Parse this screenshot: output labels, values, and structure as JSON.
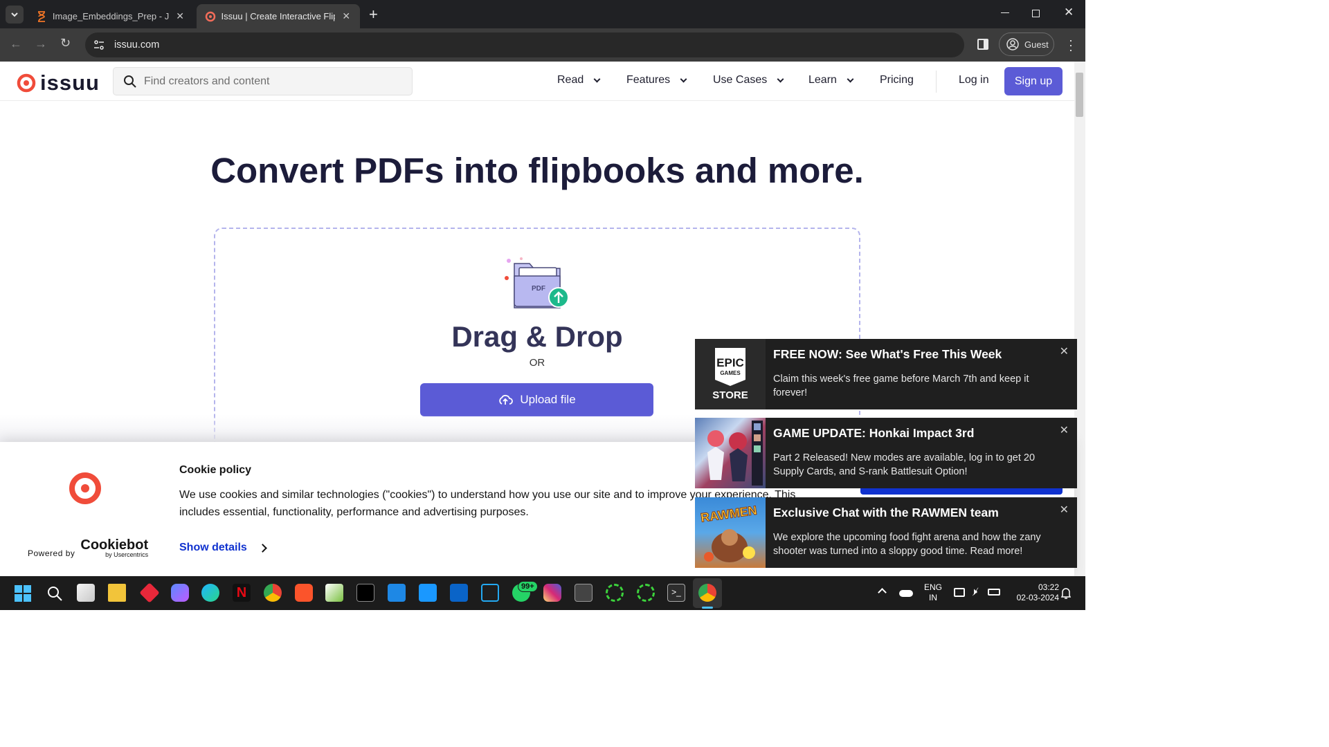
{
  "browser": {
    "tabs": [
      {
        "title": "Image_Embeddings_Prep - Jupy",
        "active": false
      },
      {
        "title": "Issuu | Create Interactive Flipbo",
        "active": true
      }
    ],
    "new_tab_glyph": "+",
    "url": "issuu.com",
    "profile_label": "Guest",
    "window_controls": {
      "minimize": "minimize-icon",
      "restore": "restore-icon",
      "close": "close-icon"
    }
  },
  "site": {
    "logo_text": "issuu",
    "search_placeholder": "Find creators and content",
    "nav": [
      {
        "label": "Read",
        "has_dropdown": true
      },
      {
        "label": "Features",
        "has_dropdown": true
      },
      {
        "label": "Use Cases",
        "has_dropdown": true
      },
      {
        "label": "Learn",
        "has_dropdown": true
      },
      {
        "label": "Pricing",
        "has_dropdown": false
      }
    ],
    "login_label": "Log in",
    "signup_label": "Sign up",
    "hero_title": "Convert PDFs into flipbooks and more.",
    "dropzone": {
      "pdf_label": "PDF",
      "title": "Drag & Drop",
      "or_label": "OR",
      "upload_label": "Upload file"
    },
    "accent_color": "#5b5bd6"
  },
  "cookie_banner": {
    "title": "Cookie policy",
    "text": "We use cookies and similar technologies (\"cookies\") to understand how you use our site and to improve your experience. This includes essential, functionality, performance and advertising purposes.",
    "powered_by": "Powered by",
    "brand": "Cookiebot",
    "brand_sub": "by Usercentrics",
    "show_details": "Show details"
  },
  "notifications": [
    {
      "thumb_line1": "EPIC",
      "thumb_line2": "GAMES",
      "thumb_line3": "STORE",
      "title": "FREE NOW: See What's Free This Week",
      "body": "Claim this week's free game before March 7th and keep it forever!"
    },
    {
      "title": "GAME UPDATE: Honkai Impact 3rd",
      "body": "Part 2 Released! New modes are available, log in to get 20 Supply Cards, and S-rank Battlesuit Option!"
    },
    {
      "thumb_text": "RAWMEN",
      "title": "Exclusive Chat with the RAWMEN team",
      "body": "We explore the upcoming food fight arena and how the zany shooter was turned into a sloppy good time. Read more!"
    }
  ],
  "taskbar": {
    "whatsapp_badge": "99+",
    "language": "ENG",
    "region": "IN",
    "time": "03:22",
    "date": "02-03-2024"
  }
}
